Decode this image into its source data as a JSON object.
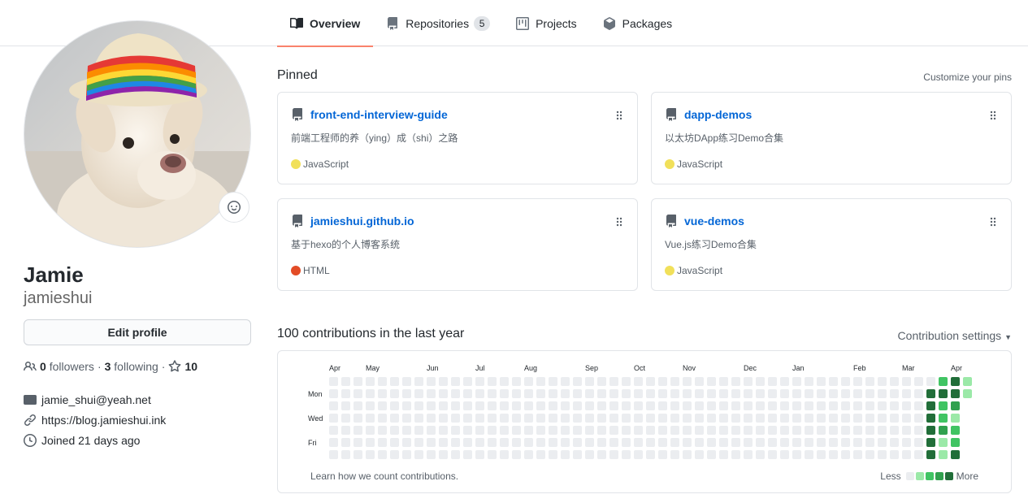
{
  "tabs": [
    {
      "label": "Overview",
      "active": true
    },
    {
      "label": "Repositories",
      "count": "5"
    },
    {
      "label": "Projects"
    },
    {
      "label": "Packages"
    }
  ],
  "profile": {
    "name": "Jamie",
    "login": "jamieshui",
    "edit_label": "Edit profile",
    "followers_count": "0",
    "followers_label": "followers",
    "following_count": "3",
    "following_label": "following",
    "stars_count": "10",
    "email": "jamie_shui@yeah.net",
    "website": "https://blog.jamieshui.ink",
    "joined": "Joined 21 days ago"
  },
  "pinned": {
    "title": "Pinned",
    "customize": "Customize your pins",
    "repos": [
      {
        "name": "front-end-interview-guide",
        "desc": "前端工程师的养（ying）成（shi）之路",
        "lang": "JavaScript",
        "lang_color": "#f1e05a"
      },
      {
        "name": "dapp-demos",
        "desc": "以太坊DApp练习Demo合集",
        "lang": "JavaScript",
        "lang_color": "#f1e05a"
      },
      {
        "name": "jamieshui.github.io",
        "desc": "基于hexo的个人博客系统",
        "lang": "HTML",
        "lang_color": "#e34c26"
      },
      {
        "name": "vue-demos",
        "desc": "Vue.js练习Demo合集",
        "lang": "JavaScript",
        "lang_color": "#f1e05a"
      }
    ]
  },
  "contributions": {
    "title": "100 contributions in the last year",
    "settings": "Contribution settings",
    "months": [
      "Apr",
      "May",
      "Jun",
      "Jul",
      "Aug",
      "Sep",
      "Oct",
      "Nov",
      "Dec",
      "Jan",
      "Feb",
      "Mar",
      "Apr"
    ],
    "weekdays": [
      "Mon",
      "Wed",
      "Fri"
    ],
    "learn": "Learn how we count contributions.",
    "less": "Less",
    "more": "More",
    "colors": [
      "#ebedf0",
      "#9be9a8",
      "#40c463",
      "#30a14e",
      "#216e39"
    ],
    "recent_weeks": [
      [
        0,
        4,
        4,
        4,
        4,
        4,
        4
      ],
      [
        2,
        4,
        2,
        2,
        3,
        1,
        1
      ],
      [
        4,
        4,
        3,
        1,
        2,
        2,
        4
      ],
      [
        1,
        1,
        null,
        null,
        null,
        null,
        null
      ]
    ]
  }
}
